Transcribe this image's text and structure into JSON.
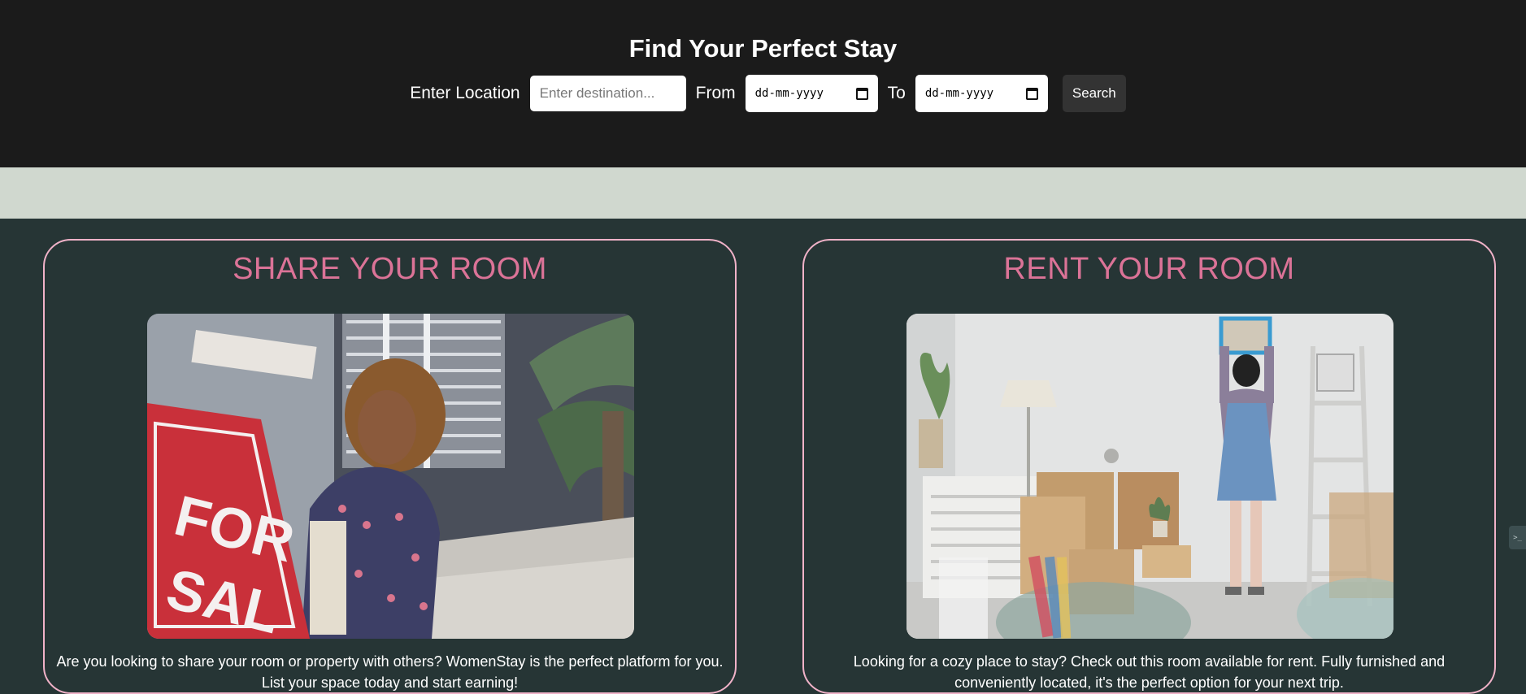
{
  "hero": {
    "title": "Find Your Perfect Stay",
    "location_label": "Enter Location",
    "location_placeholder": "Enter destination...",
    "from_label": "From",
    "from_value": "dd-mm-yyyy",
    "to_label": "To",
    "to_value": "dd-mm-yyyy",
    "search_label": "Search"
  },
  "cards": [
    {
      "title": "SHARE YOUR ROOM",
      "description": "Are you looking to share your room or property with others? WomenStay is the perfect platform for you. List your space today and start earning!"
    },
    {
      "title": "RENT YOUR ROOM",
      "description": "Looking for a cozy place to stay? Check out this room available for rent. Fully furnished and conveniently located, it's the perfect option for your next trip."
    }
  ],
  "side_tab": {
    "icon": ">_"
  },
  "colors": {
    "hero_bg": "#1b1b1b",
    "band_bg": "#d0d8cf",
    "page_bg": "#263535",
    "card_border": "#f0b2c8",
    "card_title": "#db7397"
  }
}
